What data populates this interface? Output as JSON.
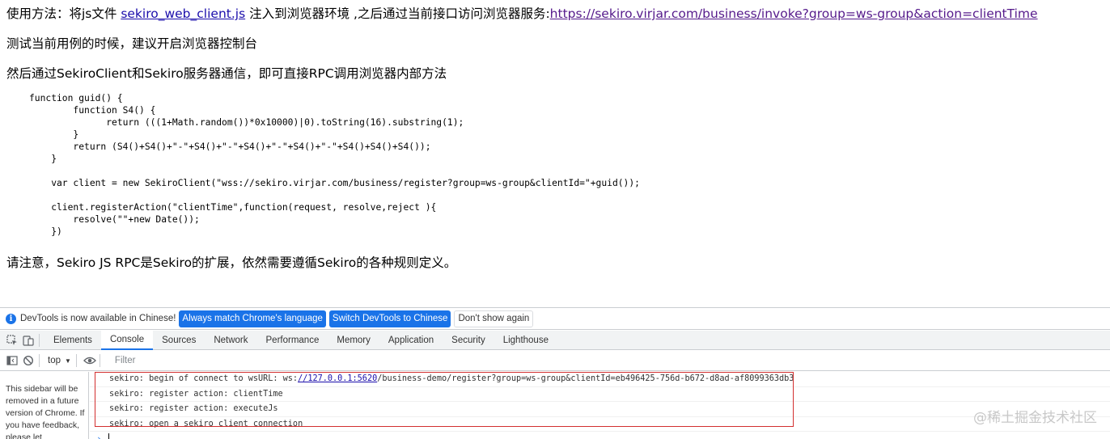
{
  "page": {
    "p1": {
      "prefix": "使用方法：将js文件 ",
      "file_link": "sekiro_web_client.js",
      "middle": " 注入到浏览器环境 ,之后通过当前接口访问浏览器服务:",
      "invoke_link": "https://sekiro.virjar.com/business/invoke?group=ws-group&action=clientTime"
    },
    "p2": "测试当前用例的时候，建议开启浏览器控制台",
    "p3": "然后通过SekiroClient和Sekiro服务器通信，即可直接RPC调用浏览器内部方法",
    "code": "function guid() {\n        function S4() {\n              return (((1+Math.random())*0x10000)|0).toString(16).substring(1);\n        }\n        return (S4()+S4()+\"-\"+S4()+\"-\"+S4()+\"-\"+S4()+\"-\"+S4()+S4()+S4());\n    }\n\n    var client = new SekiroClient(\"wss://sekiro.virjar.com/business/register?group=ws-group&clientId=\"+guid());\n\n    client.registerAction(\"clientTime\",function(request, resolve,reject ){\n        resolve(\"\"+new Date());\n    })",
    "p4": "请注意，Sekiro JS RPC是Sekiro的扩展，依然需要遵循Sekiro的各种规则定义。"
  },
  "devtools": {
    "infobar": {
      "message": "DevTools is now available in Chinese!",
      "match_button": "Always match Chrome's language",
      "switch_button": "Switch DevTools to Chinese",
      "dismiss_button": "Don't show again"
    },
    "tabs": [
      "Elements",
      "Console",
      "Sources",
      "Network",
      "Performance",
      "Memory",
      "Application",
      "Security",
      "Lighthouse"
    ],
    "active_tab": "Console",
    "console_bar": {
      "context": "top",
      "filter_placeholder": "Filter"
    },
    "sidebar_note": "This sidebar will be removed in a future version of Chrome. If you have feedback, please let",
    "logs": [
      {
        "prefix": "sekiro: begin of connect to wsURL: ws:",
        "link": "//127.0.0.1:5620",
        "suffix": "/business-demo/register?group=ws-group&clientId=eb496425-756d-b672-d8ad-af8099363db3"
      },
      {
        "text": "sekiro: register action: clientTime"
      },
      {
        "text": "sekiro: register action: executeJs"
      },
      {
        "text": "sekiro: open a sekiro client connection"
      }
    ],
    "prompt_symbol": "›"
  },
  "watermark": "@稀土掘金技术社区"
}
